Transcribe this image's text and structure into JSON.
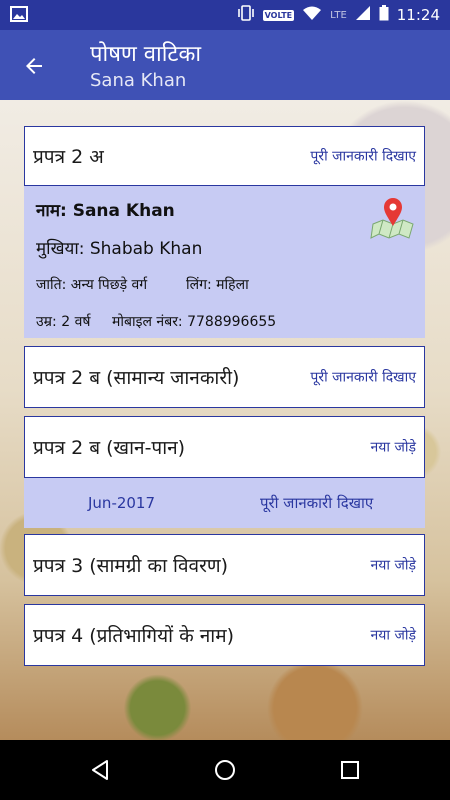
{
  "status_bar": {
    "time": "11:24",
    "volte": "VOLTE",
    "network": "LTE"
  },
  "app_bar": {
    "title": "पोषण वाटिका",
    "subtitle": "Sana Khan"
  },
  "cards": {
    "prapatra_2a": {
      "label": "प्रपत्र 2 अ",
      "action": "पूरी जानकारी दिखाए"
    },
    "prapatra_2b_general": {
      "label": "प्रपत्र 2 ब (सामान्य जानकारी)",
      "action": "पूरी जानकारी दिखाए"
    },
    "prapatra_2b_food": {
      "label": "प्रपत्र 2 ब (खान-पान)",
      "action": "नया जोड़े"
    },
    "prapatra_3": {
      "label": "प्रपत्र 3 (सामग्री का विवरण)",
      "action": "नया जोड़े"
    },
    "prapatra_4": {
      "label": "प्रपत्र 4 (प्रतिभागियों के नाम)",
      "action": "नया जोड़े"
    }
  },
  "details": {
    "name": "नाम: Sana Khan",
    "head": "मुखिया: Shabab Khan",
    "caste": "जाति: अन्य पिछड़े वर्ग",
    "gender": "लिंग: महिला",
    "age": "उम्र: 2 वर्ष",
    "mobile": "मोबाइल नंबर: 7788996655"
  },
  "food_entry": {
    "month": "Jun-2017",
    "action": "पूरी जानकारी दिखाए"
  }
}
